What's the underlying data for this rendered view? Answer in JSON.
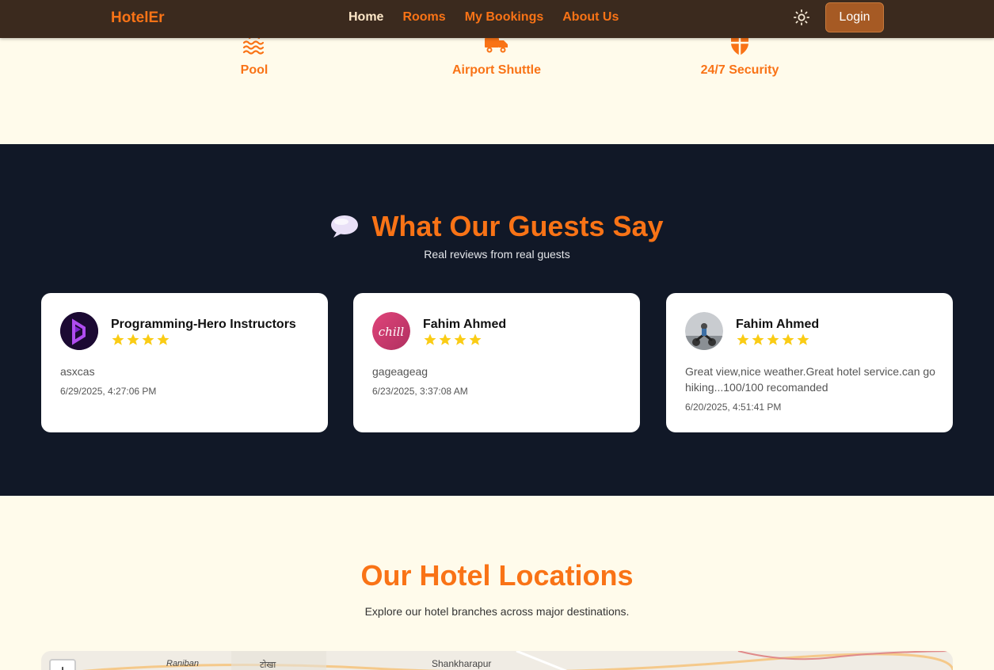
{
  "nav": {
    "brand": "HotelEr",
    "links": [
      {
        "label": "Home"
      },
      {
        "label": "Rooms"
      },
      {
        "label": "My Bookings"
      },
      {
        "label": "About Us"
      }
    ],
    "theme_icon": "sun-icon",
    "login_label": "Login"
  },
  "amenities": [
    {
      "label": "Pool",
      "icon": "pool-icon"
    },
    {
      "label": "Airport Shuttle",
      "icon": "shuttle-icon"
    },
    {
      "label": "24/7 Security",
      "icon": "shield-icon"
    }
  ],
  "reviews": {
    "title": "What Our Guests Say",
    "title_icon": "speech-bubble-icon",
    "subtitle": "Real reviews from real guests",
    "items": [
      {
        "name": "Programming-Hero Instructors",
        "rating": 4,
        "text": "asxcas",
        "date": "6/29/2025, 4:27:06 PM"
      },
      {
        "name": "Fahim Ahmed",
        "rating": 4,
        "text": "gageageag",
        "date": "6/23/2025, 3:37:08 AM"
      },
      {
        "name": "Fahim Ahmed",
        "rating": 5,
        "text": "Great view,nice weather.Great hotel service.can go hiking...100/100 recomanded",
        "date": "6/20/2025, 4:51:41 PM"
      }
    ],
    "avatar_texts": [
      "chill"
    ]
  },
  "locations": {
    "title": "Our Hotel Locations",
    "subtitle": "Explore our hotel branches across major destinations.",
    "map_places": [
      "Raniban",
      "टोखा",
      "Shankharapur"
    ],
    "zoom_in_label": "+"
  },
  "colors": {
    "accent": "#f97316",
    "nav_bg": "#3b2a1e",
    "reviews_bg": "#111827",
    "page_bg": "#fffbeb",
    "star": "#facc15"
  }
}
